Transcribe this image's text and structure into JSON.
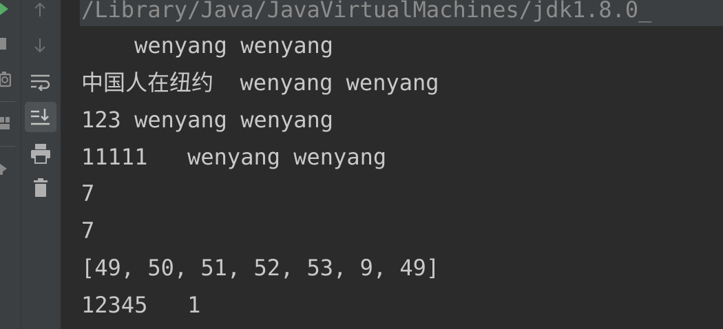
{
  "console": {
    "command_line": "/Library/Java/JavaVirtualMachines/jdk1.8.0_",
    "lines": [
      "    wenyang wenyang",
      "中国人在纽约  wenyang wenyang",
      "123 wenyang wenyang",
      "11111   wenyang wenyang",
      "7",
      "7",
      "[49, 50, 51, 52, 53, 9, 49]",
      "12345   1"
    ]
  },
  "toolbar": {
    "run_icons": [
      "run-icon",
      "stop-icon",
      "camera-icon",
      "layout-icon",
      "pin-icon"
    ],
    "tool_icons": [
      "scroll-up-icon",
      "scroll-down-icon",
      "soft-wrap-icon",
      "scroll-to-end-icon",
      "print-icon",
      "trash-icon"
    ]
  },
  "colors": {
    "background": "#2b2b2b",
    "toolbar": "#3c3f41",
    "text": "#c9c9c9",
    "run_green": "#59a869"
  }
}
